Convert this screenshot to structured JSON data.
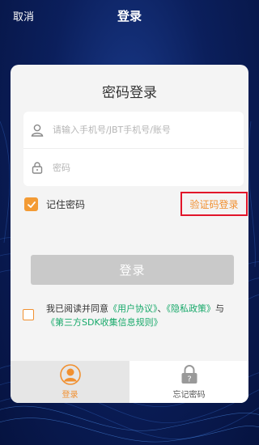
{
  "header": {
    "cancel_label": "取消",
    "title": "登录"
  },
  "card": {
    "title": "密码登录",
    "account_field": {
      "placeholder": "请输入手机号/JBT手机号/账号",
      "value": ""
    },
    "password_field": {
      "placeholder": "密码",
      "value": ""
    },
    "remember_label": "记住密码",
    "remember_checked": true,
    "sms_login_label": "验证码登录",
    "login_button_label": "登录",
    "agreement": {
      "checked": false,
      "prefix": "我已阅读并同意",
      "user_agreement": "《用户协议》",
      "separator": "、",
      "privacy_policy": "《隐私政策》",
      "and": "与",
      "sdk_rules": "《第三方SDK收集信息规则》"
    }
  },
  "tabs": [
    {
      "label": "登录",
      "icon": "person-icon",
      "active": true
    },
    {
      "label": "忘记密码",
      "icon": "lock-question-icon",
      "active": false
    }
  ],
  "colors": {
    "accent": "#f19030",
    "link": "#17a96a",
    "highlight_border": "#e2152a",
    "button_disabled": "#c9c9c9"
  }
}
